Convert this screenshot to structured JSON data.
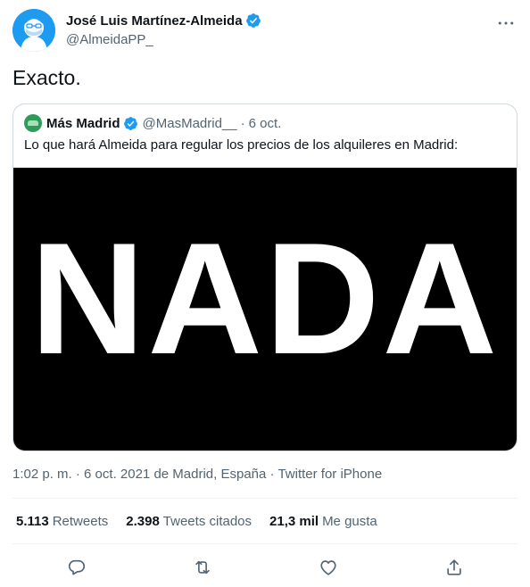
{
  "author": {
    "display_name": "José Luis Martínez-Almeida",
    "handle": "@AlmeidaPP_",
    "verified_icon": "verified-badge-icon"
  },
  "tweet": {
    "text": "Exacto."
  },
  "quoted": {
    "display_name": "Más Madrid",
    "handle": "@MasMadrid__",
    "separator": "·",
    "time": "6 oct.",
    "text": "Lo que hará Almeida para regular los precios de los alquileres en Madrid:",
    "media_text": "NADA"
  },
  "meta": {
    "time": "1:02 p. m.",
    "sep1": "·",
    "date_location": "6 oct. 2021 de Madrid, España",
    "sep2": "·",
    "source": "Twitter for iPhone"
  },
  "stats": {
    "retweets_count": "5.113",
    "retweets_label": "Retweets",
    "quotes_count": "2.398",
    "quotes_label": "Tweets citados",
    "likes_count": "21,3 mil",
    "likes_label": "Me gusta"
  },
  "colors": {
    "accent": "#1d9bf0",
    "text": "#0f1419",
    "secondary": "#536471",
    "border": "#cfd9de"
  }
}
